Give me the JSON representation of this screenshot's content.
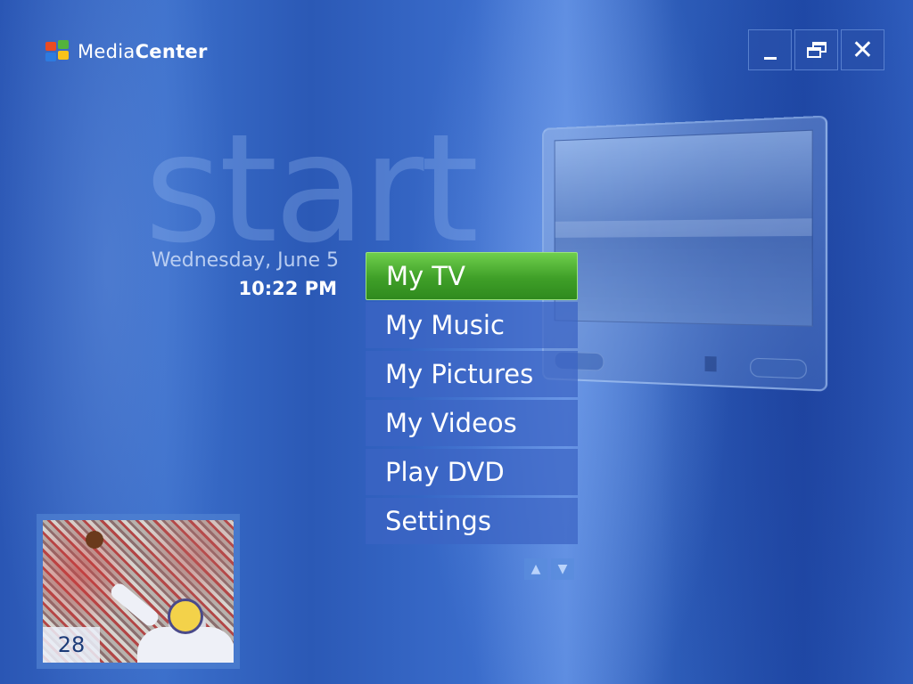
{
  "header": {
    "logo_part1": "Media",
    "logo_part2": "Center"
  },
  "window_controls": {
    "minimize": "minimize",
    "restore": "restore",
    "close": "✕"
  },
  "watermark": "start",
  "clock": {
    "date": "Wednesday, June 5",
    "time": "10:22 PM"
  },
  "menu": {
    "items": [
      {
        "label": "My TV",
        "selected": true
      },
      {
        "label": "My Music"
      },
      {
        "label": "My Pictures"
      },
      {
        "label": "My Videos"
      },
      {
        "label": "Play DVD"
      },
      {
        "label": "Settings"
      }
    ]
  },
  "scroll": {
    "up": "▲",
    "down": "▼"
  },
  "preview": {
    "channel": "28"
  },
  "colors": {
    "selected": "#3f9f28",
    "background": "#2a56b4"
  }
}
